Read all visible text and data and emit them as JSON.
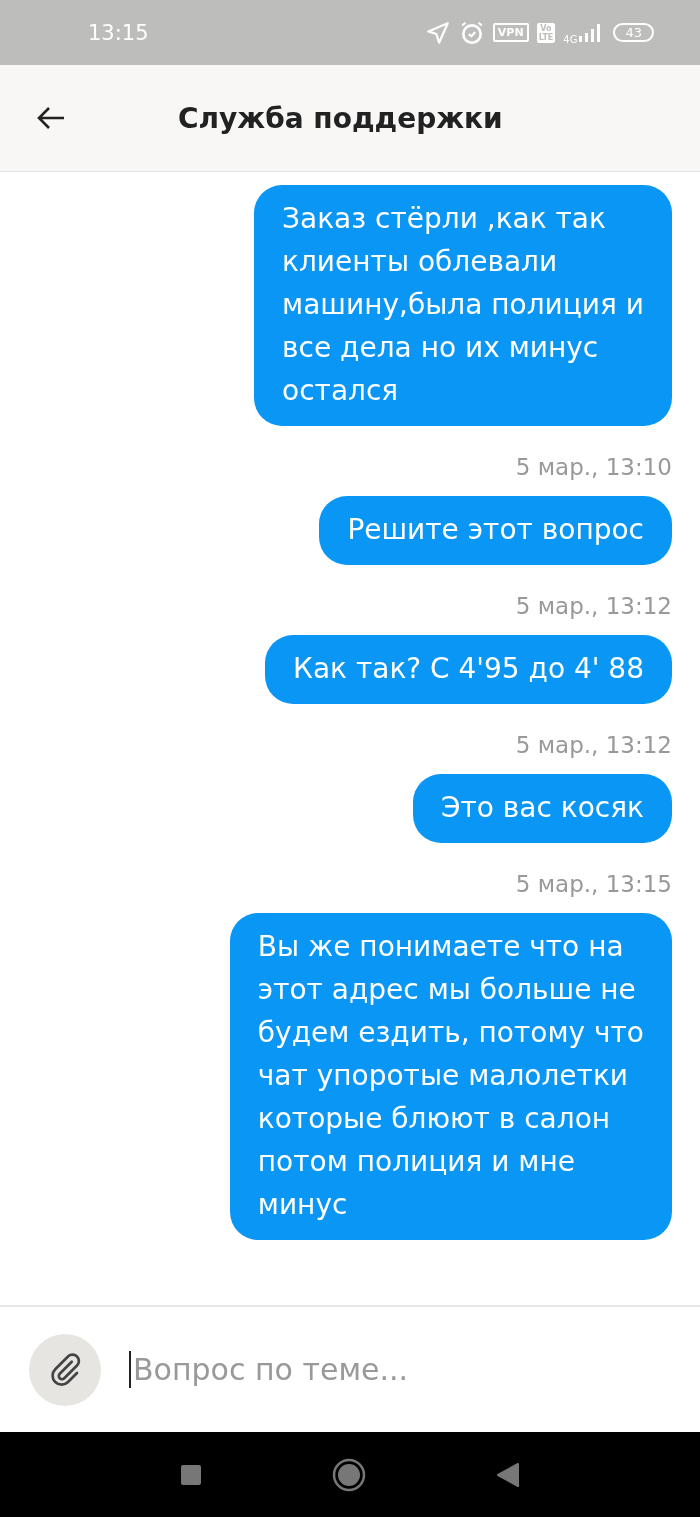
{
  "status_bar": {
    "time": "13:15",
    "vpn": "VPN",
    "volte": "Vo\nLTE",
    "network": "4G",
    "battery": "43"
  },
  "header": {
    "title": "Служба поддержки"
  },
  "messages": [
    {
      "text": "Заказ стёрли ,как так\nклиенты облевали\nмашину,была полиция и\nвсе дела но их минус\nостался"
    },
    {
      "time": "5 мар., 13:10",
      "text": "Решите этот вопрос"
    },
    {
      "time": "5 мар., 13:12",
      "text": "Как так? С 4'95 до 4' 88"
    },
    {
      "time": "5 мар., 13:12",
      "text": "Это вас косяк"
    },
    {
      "time": "5 мар., 13:15",
      "text": "Вы же понимаете что на\nэтот адрес мы больше не\nбудем ездить, потому что\nчат упоротые малолетки\nкоторые блюют в салон\nпотом полиция и мне\nминус"
    }
  ],
  "composer": {
    "placeholder": "Вопрос по теме..."
  }
}
